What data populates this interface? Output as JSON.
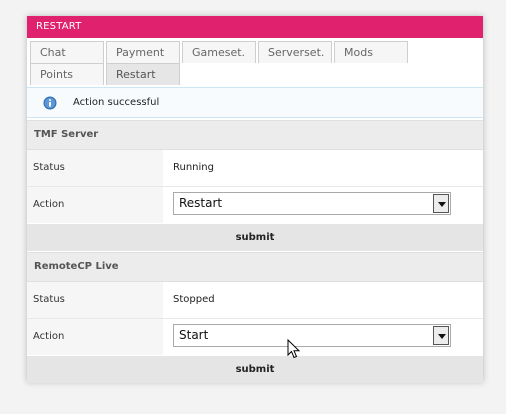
{
  "window": {
    "title": "RESTART"
  },
  "tabs": [
    {
      "label": "Chat"
    },
    {
      "label": "Payment"
    },
    {
      "label": "Gameset."
    },
    {
      "label": "Serverset."
    },
    {
      "label": "Mods"
    },
    {
      "label": "Points"
    },
    {
      "label": "Restart",
      "active": true
    }
  ],
  "notice": {
    "text": "Action successful",
    "icon": "info-icon",
    "color": "#2f6fb5"
  },
  "sections": [
    {
      "title": "TMF Server",
      "status_label": "Status",
      "status_value": "Running",
      "action_label": "Action",
      "action_selected": "Restart",
      "submit_label": "submit"
    },
    {
      "title": "RemoteCP Live",
      "status_label": "Status",
      "status_value": "Stopped",
      "action_label": "Action",
      "action_selected": "Start",
      "submit_label": "submit"
    }
  ],
  "colors": {
    "accent": "#e0226e"
  }
}
